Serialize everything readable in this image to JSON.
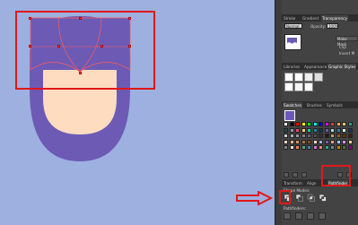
{
  "colors": {
    "canvas_bg": "#9db0e0",
    "hair": "#6c5ab5",
    "face": "#fddcc0",
    "highlight": "#e01818"
  },
  "panel": {
    "top_tabs": [
      "Stroke",
      "Gradient",
      "Transparency"
    ],
    "blend_mode": "Normal",
    "opacity_label": "Opacity:",
    "opacity_value": "100%",
    "make_mask_label": "Make Mask",
    "clip_label": "Clip",
    "invert_mask_label": "Invert M",
    "mid_tabs": [
      "Libraries",
      "Appearance",
      "Graphic Styles"
    ],
    "swatches_tabs": [
      "Swatches",
      "Brushes",
      "Symbols"
    ],
    "bottom_tabs": [
      "Transform",
      "Align",
      "Pathfinder"
    ],
    "shape_modes_label": "Shape Modes:",
    "pathfinders_label": "Pathfinders:"
  },
  "icons": {
    "unite": "unite-icon",
    "minus_front": "minus-front-icon",
    "intersect": "intersect-icon",
    "exclude": "exclude-icon",
    "arrow": "arrow-right-icon"
  }
}
